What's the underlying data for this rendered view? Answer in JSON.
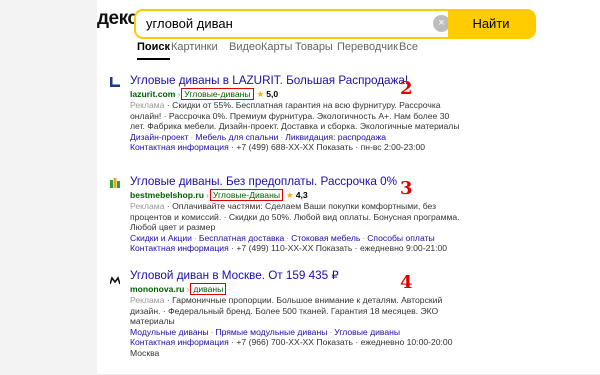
{
  "header": {
    "logo_fragment": "декс",
    "search_value": "угловой диван",
    "clear_icon": "×",
    "search_button": "Найти"
  },
  "tabs": [
    "Поиск",
    "Картинки",
    "Видео",
    "Карты",
    "Товары",
    "Переводчик",
    "Все"
  ],
  "results": [
    {
      "number": "2",
      "title": "Угловые диваны в LAZURIT. Большая Распродажа!",
      "domain": "lazurit.com",
      "crumb": "Угловые-диваны",
      "rating": "5,0",
      "ad_label": "Реклама",
      "desc": " · Скидки от 55%. Бесплатная гарантия на всю фурнитуру. Рассрочка онлайн! · Рассрочка 0%. Премиум фурнитура. Экологичность А+. Нам более 30 лет. Фабрика мебели. Дизайн-проект. Доставка и сборка. Экологичные материалы",
      "links": [
        "Дизайн-проект",
        "Мебель для спальни",
        "Ликвидация: распродажа"
      ],
      "contact": {
        "label": "Контактная информация",
        "phone": "+7 (499) 688-XX-XX Показать",
        "hours": "пн-вс 2:00-23:00"
      }
    },
    {
      "number": "3",
      "title": "Угловые диваны. Без предоплаты. Рассрочка 0%",
      "domain": "bestmebelshop.ru",
      "crumb": "Угловые-Диваны",
      "rating": "4,3",
      "ad_label": "Реклама",
      "desc": " · Оплачивайте частями: Сделаем Ваши покупки комфортными, без процентов и комиссий. · Скидки до 50%. Любой вид оплаты. Бонусная программа. Любой цвет и размер",
      "links": [
        "Скидки и Акции",
        "Бесплатная доставка",
        "Стоковая мебель",
        "Способы оплаты"
      ],
      "contact": {
        "label": "Контактная информация",
        "phone": "+7 (499) 110-XX-XX Показать",
        "hours": "ежедневно 9:00-21:00"
      }
    },
    {
      "number": "4",
      "title": "Угловой диван в Москве. От 159 435 ₽",
      "domain": "mononova.ru",
      "crumb": "диваны",
      "rating": "",
      "ad_label": "Реклама",
      "desc": " · Гармоничные пропорции. Большое внимание к деталям. Авторский дизайн. · Федеральный бренд. Более 500 тканей. Гарантия 18 месяцев. ЭКО материалы",
      "links": [
        "Модульные диваны",
        "Прямые модульные диваны",
        "Угловые диваны"
      ],
      "contact": {
        "label": "Контактная информация",
        "phone": "+7 (966) 700-XX-XX Показать",
        "hours": "ежедневно 10:00-20:00"
      },
      "city": "Москва"
    }
  ],
  "colors": {
    "accent": "#ffcc00",
    "title": "#1a0dab",
    "url": "#007000",
    "highlight": "#e00000"
  },
  "favicons": [
    "lazurit-logo-icon",
    "bestmebelshop-logo-icon",
    "mononova-logo-icon"
  ]
}
